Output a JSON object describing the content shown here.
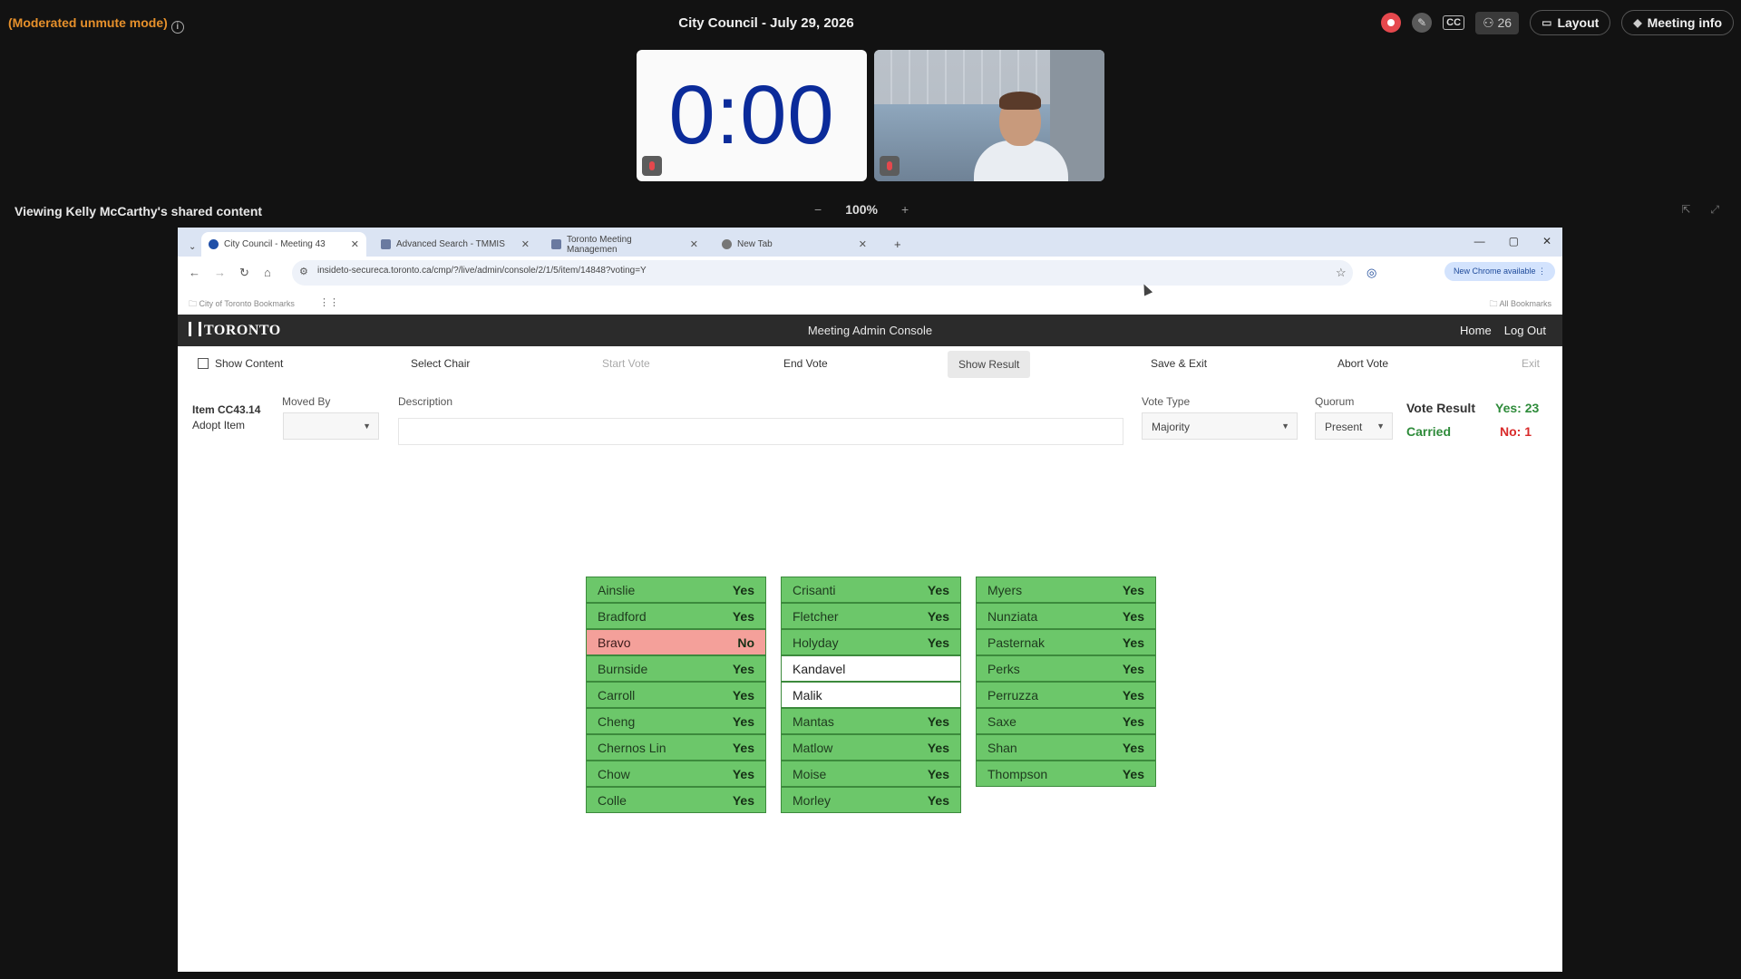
{
  "topbar": {
    "mode_text": "(Moderated unmute mode)",
    "meeting_title": "City Council - July 29, 2026",
    "participant_count": "26",
    "cc_label": "CC",
    "layout_label": "Layout",
    "meeting_info_label": "Meeting info",
    "recording_color": "#e5484d"
  },
  "tiles": {
    "timer_text": "0:00"
  },
  "share": {
    "viewing_label": "Viewing Kelly McCarthy's shared content",
    "zoom_minus": "−",
    "zoom_value": "100%",
    "zoom_plus": "+"
  },
  "browser": {
    "tabs": [
      {
        "label": "City Council - Meeting 43"
      },
      {
        "label": "Advanced Search - TMMIS"
      },
      {
        "label": "Toronto Meeting Managemen"
      },
      {
        "label": "New Tab"
      }
    ],
    "new_tab_symbol": "+",
    "url": "insideto-secureca.toronto.ca/cmp/?/live/admin/console/2/1/5/item/14848?voting=Y",
    "chrome_update_label": "New Chrome available",
    "bookmark_left": "City of Toronto Bookmarks",
    "bookmark_right": "All Bookmarks"
  },
  "app": {
    "logo_text": "TORONTO",
    "title": "Meeting Admin Console",
    "home_link": "Home",
    "logout_link": "Log Out",
    "toolbar": {
      "show_content": "Show Content",
      "select_chair": "Select Chair",
      "start_vote": "Start Vote",
      "end_vote": "End Vote",
      "show_result": "Show Result",
      "save_exit": "Save & Exit",
      "abort_vote": "Abort Vote",
      "exit": "Exit"
    },
    "form": {
      "item_id": "Item CC43.14",
      "item_action": "Adopt Item",
      "moved_by_label": "Moved By",
      "moved_by_value": "",
      "description_label": "Description",
      "vote_type_label": "Vote Type",
      "vote_type_value": "Majority",
      "quorum_label": "Quorum",
      "quorum_value": "Present",
      "vote_result_label": "Vote Result",
      "result_status": "Carried",
      "yes_count": "Yes: 23",
      "no_count": "No: 1"
    },
    "votes": {
      "col1": [
        {
          "name": "Ainslie",
          "vote": "Yes"
        },
        {
          "name": "Bradford",
          "vote": "Yes"
        },
        {
          "name": "Bravo",
          "vote": "No"
        },
        {
          "name": "Burnside",
          "vote": "Yes"
        },
        {
          "name": "Carroll",
          "vote": "Yes"
        },
        {
          "name": "Cheng",
          "vote": "Yes"
        },
        {
          "name": "Chernos Lin",
          "vote": "Yes"
        },
        {
          "name": "Chow",
          "vote": "Yes"
        },
        {
          "name": "Colle",
          "vote": "Yes"
        }
      ],
      "col2": [
        {
          "name": "Crisanti",
          "vote": "Yes"
        },
        {
          "name": "Fletcher",
          "vote": "Yes"
        },
        {
          "name": "Holyday",
          "vote": "Yes"
        },
        {
          "name": "Kandavel",
          "vote": ""
        },
        {
          "name": "Malik",
          "vote": ""
        },
        {
          "name": "Mantas",
          "vote": "Yes"
        },
        {
          "name": "Matlow",
          "vote": "Yes"
        },
        {
          "name": "Moise",
          "vote": "Yes"
        },
        {
          "name": "Morley",
          "vote": "Yes"
        }
      ],
      "col3": [
        {
          "name": "Myers",
          "vote": "Yes"
        },
        {
          "name": "Nunziata",
          "vote": "Yes"
        },
        {
          "name": "Pasternak",
          "vote": "Yes"
        },
        {
          "name": "Perks",
          "vote": "Yes"
        },
        {
          "name": "Perruzza",
          "vote": "Yes"
        },
        {
          "name": "Saxe",
          "vote": "Yes"
        },
        {
          "name": "Shan",
          "vote": "Yes"
        },
        {
          "name": "Thompson",
          "vote": "Yes"
        }
      ]
    },
    "colors": {
      "yes": "#6cc76a",
      "no": "#f4a09a",
      "carried": "#2e8b3a",
      "no_count": "#d92a2a"
    }
  }
}
